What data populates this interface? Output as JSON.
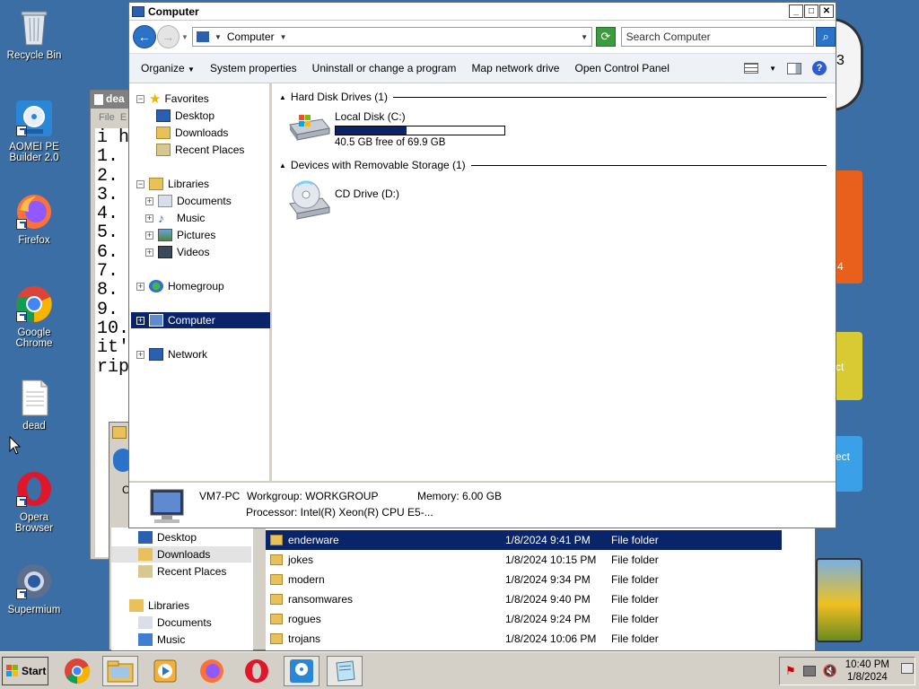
{
  "desktop": {
    "icons": [
      {
        "label": "Recycle Bin"
      },
      {
        "label": "AOMEI PE Builder 2.0"
      },
      {
        "label": "Firefox"
      },
      {
        "label": "Google Chrome"
      },
      {
        "label": "dead"
      },
      {
        "label": "Opera Browser"
      },
      {
        "label": "Supermium"
      }
    ]
  },
  "notepad": {
    "title": "dea",
    "menu_file": "File",
    "menu_edit": "E",
    "lines": "i h\n1.\n2.\n3.\n4.\n5.\n6.\n7.\n8.\n9.\n10.\nit'\nrip"
  },
  "explorer": {
    "title": "Computer",
    "address": "Computer",
    "search_placeholder": "Search Computer",
    "toolbar": {
      "organize": "Organize",
      "system_properties": "System properties",
      "uninstall": "Uninstall or change a program",
      "map_drive": "Map network drive",
      "control_panel": "Open Control Panel"
    },
    "nav": {
      "favorites": "Favorites",
      "desktop": "Desktop",
      "downloads": "Downloads",
      "recent": "Recent Places",
      "libraries": "Libraries",
      "documents": "Documents",
      "music": "Music",
      "pictures": "Pictures",
      "videos": "Videos",
      "homegroup": "Homegroup",
      "computer": "Computer",
      "network": "Network"
    },
    "groups": {
      "hdd": "Hard Disk Drives (1)",
      "removable": "Devices with Removable Storage (1)"
    },
    "drives": {
      "local": {
        "name": "Local Disk (C:)",
        "free": "40.5 GB free of 69.9 GB",
        "used_fraction": 0.42
      },
      "cd": {
        "name": "CD Drive (D:)"
      }
    },
    "details": {
      "pc_name": "VM7-PC",
      "workgroup": "Workgroup: WORKGROUP",
      "memory": "Memory: 6.00 GB",
      "processor": "Processor: Intel(R) Xeon(R) CPU E5-..."
    }
  },
  "explorer2": {
    "crumb": "C",
    "nav": {
      "desktop": "Desktop",
      "downloads": "Downloads",
      "recent": "Recent Places",
      "libraries": "Libraries",
      "documents": "Documents",
      "music": "Music"
    },
    "files": [
      {
        "name": "enderware",
        "date": "1/8/2024 9:41 PM",
        "type": "File folder"
      },
      {
        "name": "jokes",
        "date": "1/8/2024 10:15 PM",
        "type": "File folder"
      },
      {
        "name": "modern",
        "date": "1/8/2024 9:34 PM",
        "type": "File folder"
      },
      {
        "name": "ransomwares",
        "date": "1/8/2024 9:40 PM",
        "type": "File folder"
      },
      {
        "name": "rogues",
        "date": "1/8/2024 9:24 PM",
        "type": "File folder"
      },
      {
        "name": "trojans",
        "date": "1/8/2024 10:06 PM",
        "type": "File folder"
      }
    ]
  },
  "widgets": {
    "calendar_digit": "4",
    "card1": "ct",
    "card2": "ect"
  },
  "taskbar": {
    "start": "Start",
    "time": "10:40 PM",
    "date": "1/8/2024"
  }
}
